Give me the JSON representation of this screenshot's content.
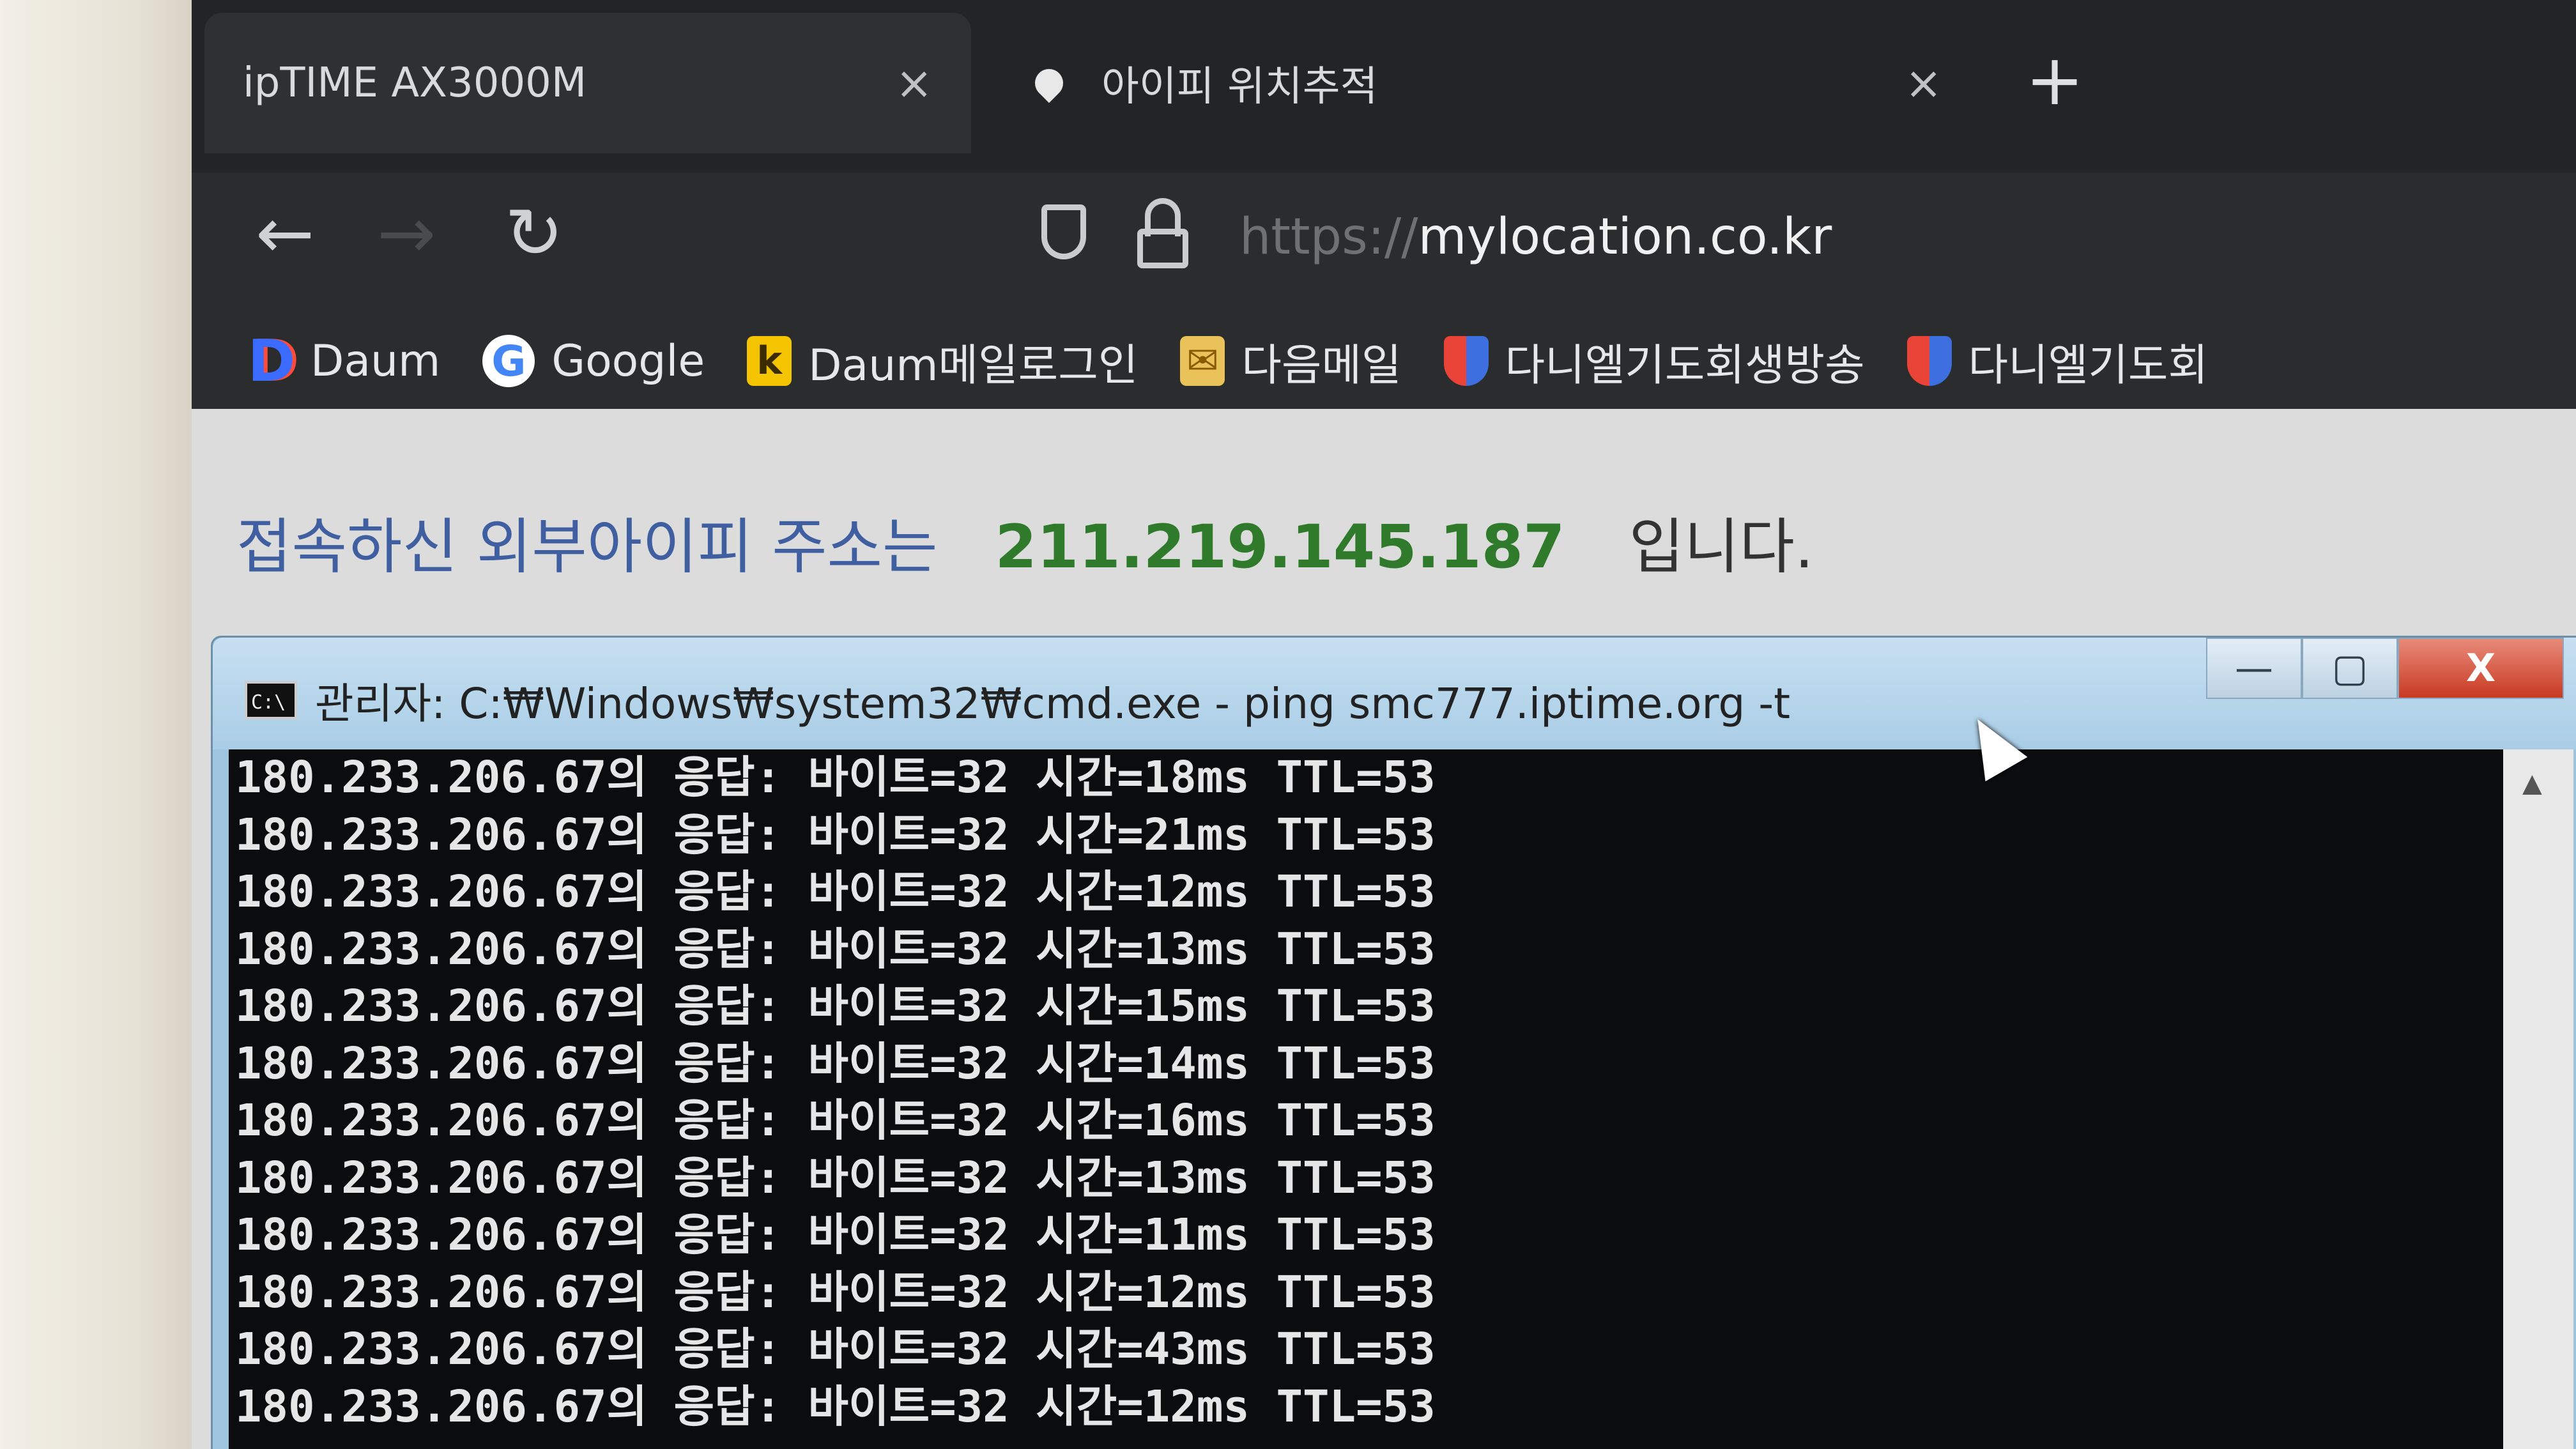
{
  "browser": {
    "tabs": [
      {
        "label": "ipTIME AX3000M",
        "close": "×"
      },
      {
        "label": "아이피 위치추적",
        "close": "×"
      }
    ],
    "new_tab": "+",
    "url_protocol": "https://",
    "url_host": "mylocation.co.kr",
    "bookmarks": [
      {
        "label": "Daum",
        "icon": "D"
      },
      {
        "label": "Google",
        "icon": "G"
      },
      {
        "label": "Daum메일로그인",
        "icon": "k"
      },
      {
        "label": "다음메일",
        "icon": "✉"
      },
      {
        "label": "다니엘기도회생방송",
        "icon": ""
      },
      {
        "label": "다니엘기도회",
        "icon": ""
      }
    ]
  },
  "page": {
    "ip_label": "접속하신 외부아이피 주소는",
    "ip_address": "211.219.145.187",
    "ip_suffix": "입니다."
  },
  "cmd": {
    "icon_text": "C:\\",
    "title": "관리자: C:₩Windows₩system32₩cmd.exe - ping  smc777.iptime.org -t",
    "buttons": {
      "minimize": "—",
      "maximize": "▢",
      "close": "X"
    },
    "lines": [
      "180.233.206.67의 응답: 바이트=32 시간=18ms TTL=53",
      "180.233.206.67의 응답: 바이트=32 시간=21ms TTL=53",
      "180.233.206.67의 응답: 바이트=32 시간=12ms TTL=53",
      "180.233.206.67의 응답: 바이트=32 시간=13ms TTL=53",
      "180.233.206.67의 응답: 바이트=32 시간=15ms TTL=53",
      "180.233.206.67의 응답: 바이트=32 시간=14ms TTL=53",
      "180.233.206.67의 응답: 바이트=32 시간=16ms TTL=53",
      "180.233.206.67의 응답: 바이트=32 시간=13ms TTL=53",
      "180.233.206.67의 응답: 바이트=32 시간=11ms TTL=53",
      "180.233.206.67의 응답: 바이트=32 시간=12ms TTL=53",
      "180.233.206.67의 응답: 바이트=32 시간=43ms TTL=53",
      "180.233.206.67의 응답: 바이트=32 시간=12ms TTL=53"
    ]
  }
}
